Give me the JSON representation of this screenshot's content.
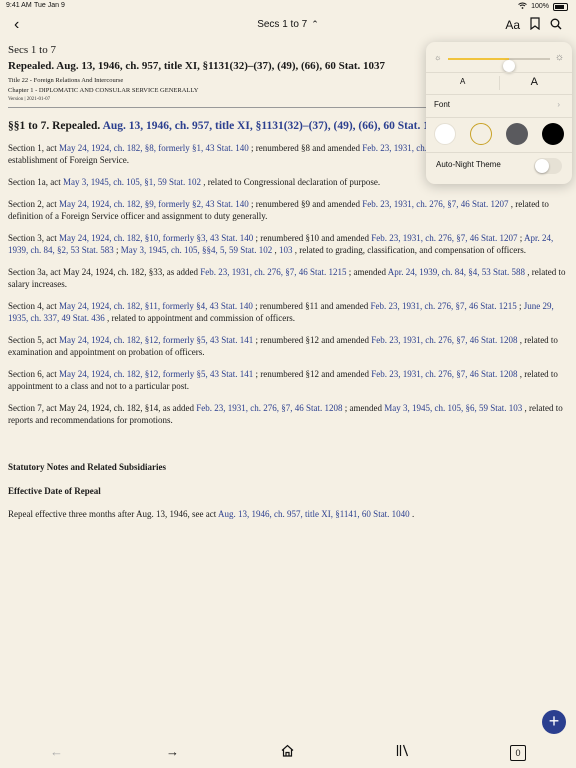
{
  "status": {
    "time": "9:41 AM",
    "date": "Tue Jan 9",
    "battery": "100%"
  },
  "nav": {
    "title": "Secs 1 to 7",
    "back_icon": "chevron-left-icon"
  },
  "doc": {
    "secs": "Secs 1 to 7",
    "repealed_line": "Repealed. Aug. 13, 1946, ch. 957, title XI, §1131(32)–(37), (49), (66), 60 Stat. 1037",
    "title": "Title 22 - Foreign Relations And Intercourse",
    "chapter": "Chapter 1 - DIPLOMATIC AND CONSULAR SERVICE GENERALLY",
    "version": "Version | 2021-01-07",
    "h2_prefix": "§§1 to 7. Repealed.",
    "h2_link": "Aug. 13, 1946, ch. 957, title XI, §1131(32)–(37), (49), (66), 60 Stat. 1037",
    "p1": {
      "a": "Section 1, act",
      "l1": "May 24, 1924, ch. 182, §8, formerly §1, 43 Stat. 140",
      "b": "; renumbered §8 and amended",
      "l2": "Feb. 23, 1931, ch. 276, §7, 46 Stat. 1207",
      "c": ", related to establishment of Foreign Service."
    },
    "p1a": {
      "a": "Section 1a, act",
      "l1": "May 3, 1945, ch. 105, §1, 59 Stat. 102",
      "b": ", related to Congressional declaration of purpose."
    },
    "p2": {
      "a": "Section 2, act",
      "l1": "May 24, 1924, ch. 182, §9, formerly §2, 43 Stat. 140",
      "b": "; renumbered §9 and amended",
      "l2": "Feb. 23, 1931, ch. 276, §7, 46 Stat. 1207",
      "c": ", related to definition of a Foreign Service officer and assignment to duty generally."
    },
    "p3": {
      "a": "Section 3, act",
      "l1": "May 24, 1924, ch. 182, §10, formerly §3, 43 Stat. 140",
      "b": "; renumbered §10 and amended",
      "l2": "Feb. 23, 1931, ch. 276, §7, 46 Stat. 1207",
      "c": ";",
      "l3": "Apr. 24, 1939, ch. 84, §2, 53 Stat. 583",
      "d": ";",
      "l4": "May 3, 1945, ch. 105, §§4, 5, 59 Stat. 102",
      "e": ",",
      "l5": "103",
      "f": ", related to grading, classification, and compensation of officers."
    },
    "p3a": {
      "a": "Section 3a, act May 24, 1924, ch. 182, §33, as added",
      "l1": "Feb. 23, 1931, ch. 276, §7, 46 Stat. 1215",
      "b": "; amended",
      "l2": "Apr. 24, 1939, ch. 84, §4, 53 Stat. 588",
      "c": ", related to salary increases."
    },
    "p4": {
      "a": "Section 4, act",
      "l1": "May 24, 1924, ch. 182, §11, formerly §4, 43 Stat. 140",
      "b": "; renumbered §11 and amended",
      "l2": "Feb. 23, 1931, ch. 276, §7, 46 Stat. 1215",
      "c": ";",
      "l3": "June 29, 1935, ch. 337, 49 Stat. 436",
      "d": ", related to appointment and commission of officers."
    },
    "p5": {
      "a": "Section 5, act",
      "l1": "May 24, 1924, ch. 182, §12, formerly §5, 43 Stat. 141",
      "b": "; renumbered §12 and amended",
      "l2": "Feb. 23, 1931, ch. 276, §7, 46 Stat. 1208",
      "c": ", related to examination and appointment on probation of officers."
    },
    "p6": {
      "a": "Section 6, act",
      "l1": "May 24, 1924, ch. 182, §12, formerly §5, 43 Stat. 141",
      "b": "; renumbered §12 and amended",
      "l2": "Feb. 23, 1931, ch. 276, §7, 46 Stat. 1208",
      "c": ", related to appointment to a class and not to a particular post."
    },
    "p7": {
      "a": "Section 7, act May 24, 1924, ch. 182, §14, as added",
      "l1": "Feb. 23, 1931, ch. 276, §7, 46 Stat. 1208",
      "b": "; amended",
      "l2": "May 3, 1945, ch. 105, §6, 59 Stat. 103",
      "c": ", related to reports and recommendations for promotions."
    },
    "notes_heading": "Statutory Notes and Related Subsidiaries",
    "eff_heading": "Effective Date of Repeal",
    "eff": {
      "a": "Repeal effective three months after Aug. 13, 1946, see act",
      "l1": "Aug. 13, 1946, ch. 957, title XI, §1141, 60 Stat. 1040",
      "b": "."
    }
  },
  "popup": {
    "brightness": 0.6,
    "size_small": "A",
    "size_large": "A",
    "font_label": "Font",
    "auto_night": "Auto-Night Theme",
    "auto_night_on": false,
    "themes": [
      {
        "name": "white",
        "color": "#ffffff",
        "selected": false
      },
      {
        "name": "sepia",
        "color": "#f4efe3",
        "selected": true
      },
      {
        "name": "gray",
        "color": "#5a5a5e",
        "selected": false
      },
      {
        "name": "black",
        "color": "#000000",
        "selected": false
      }
    ]
  },
  "toolbar": {
    "tab_count": "0"
  }
}
